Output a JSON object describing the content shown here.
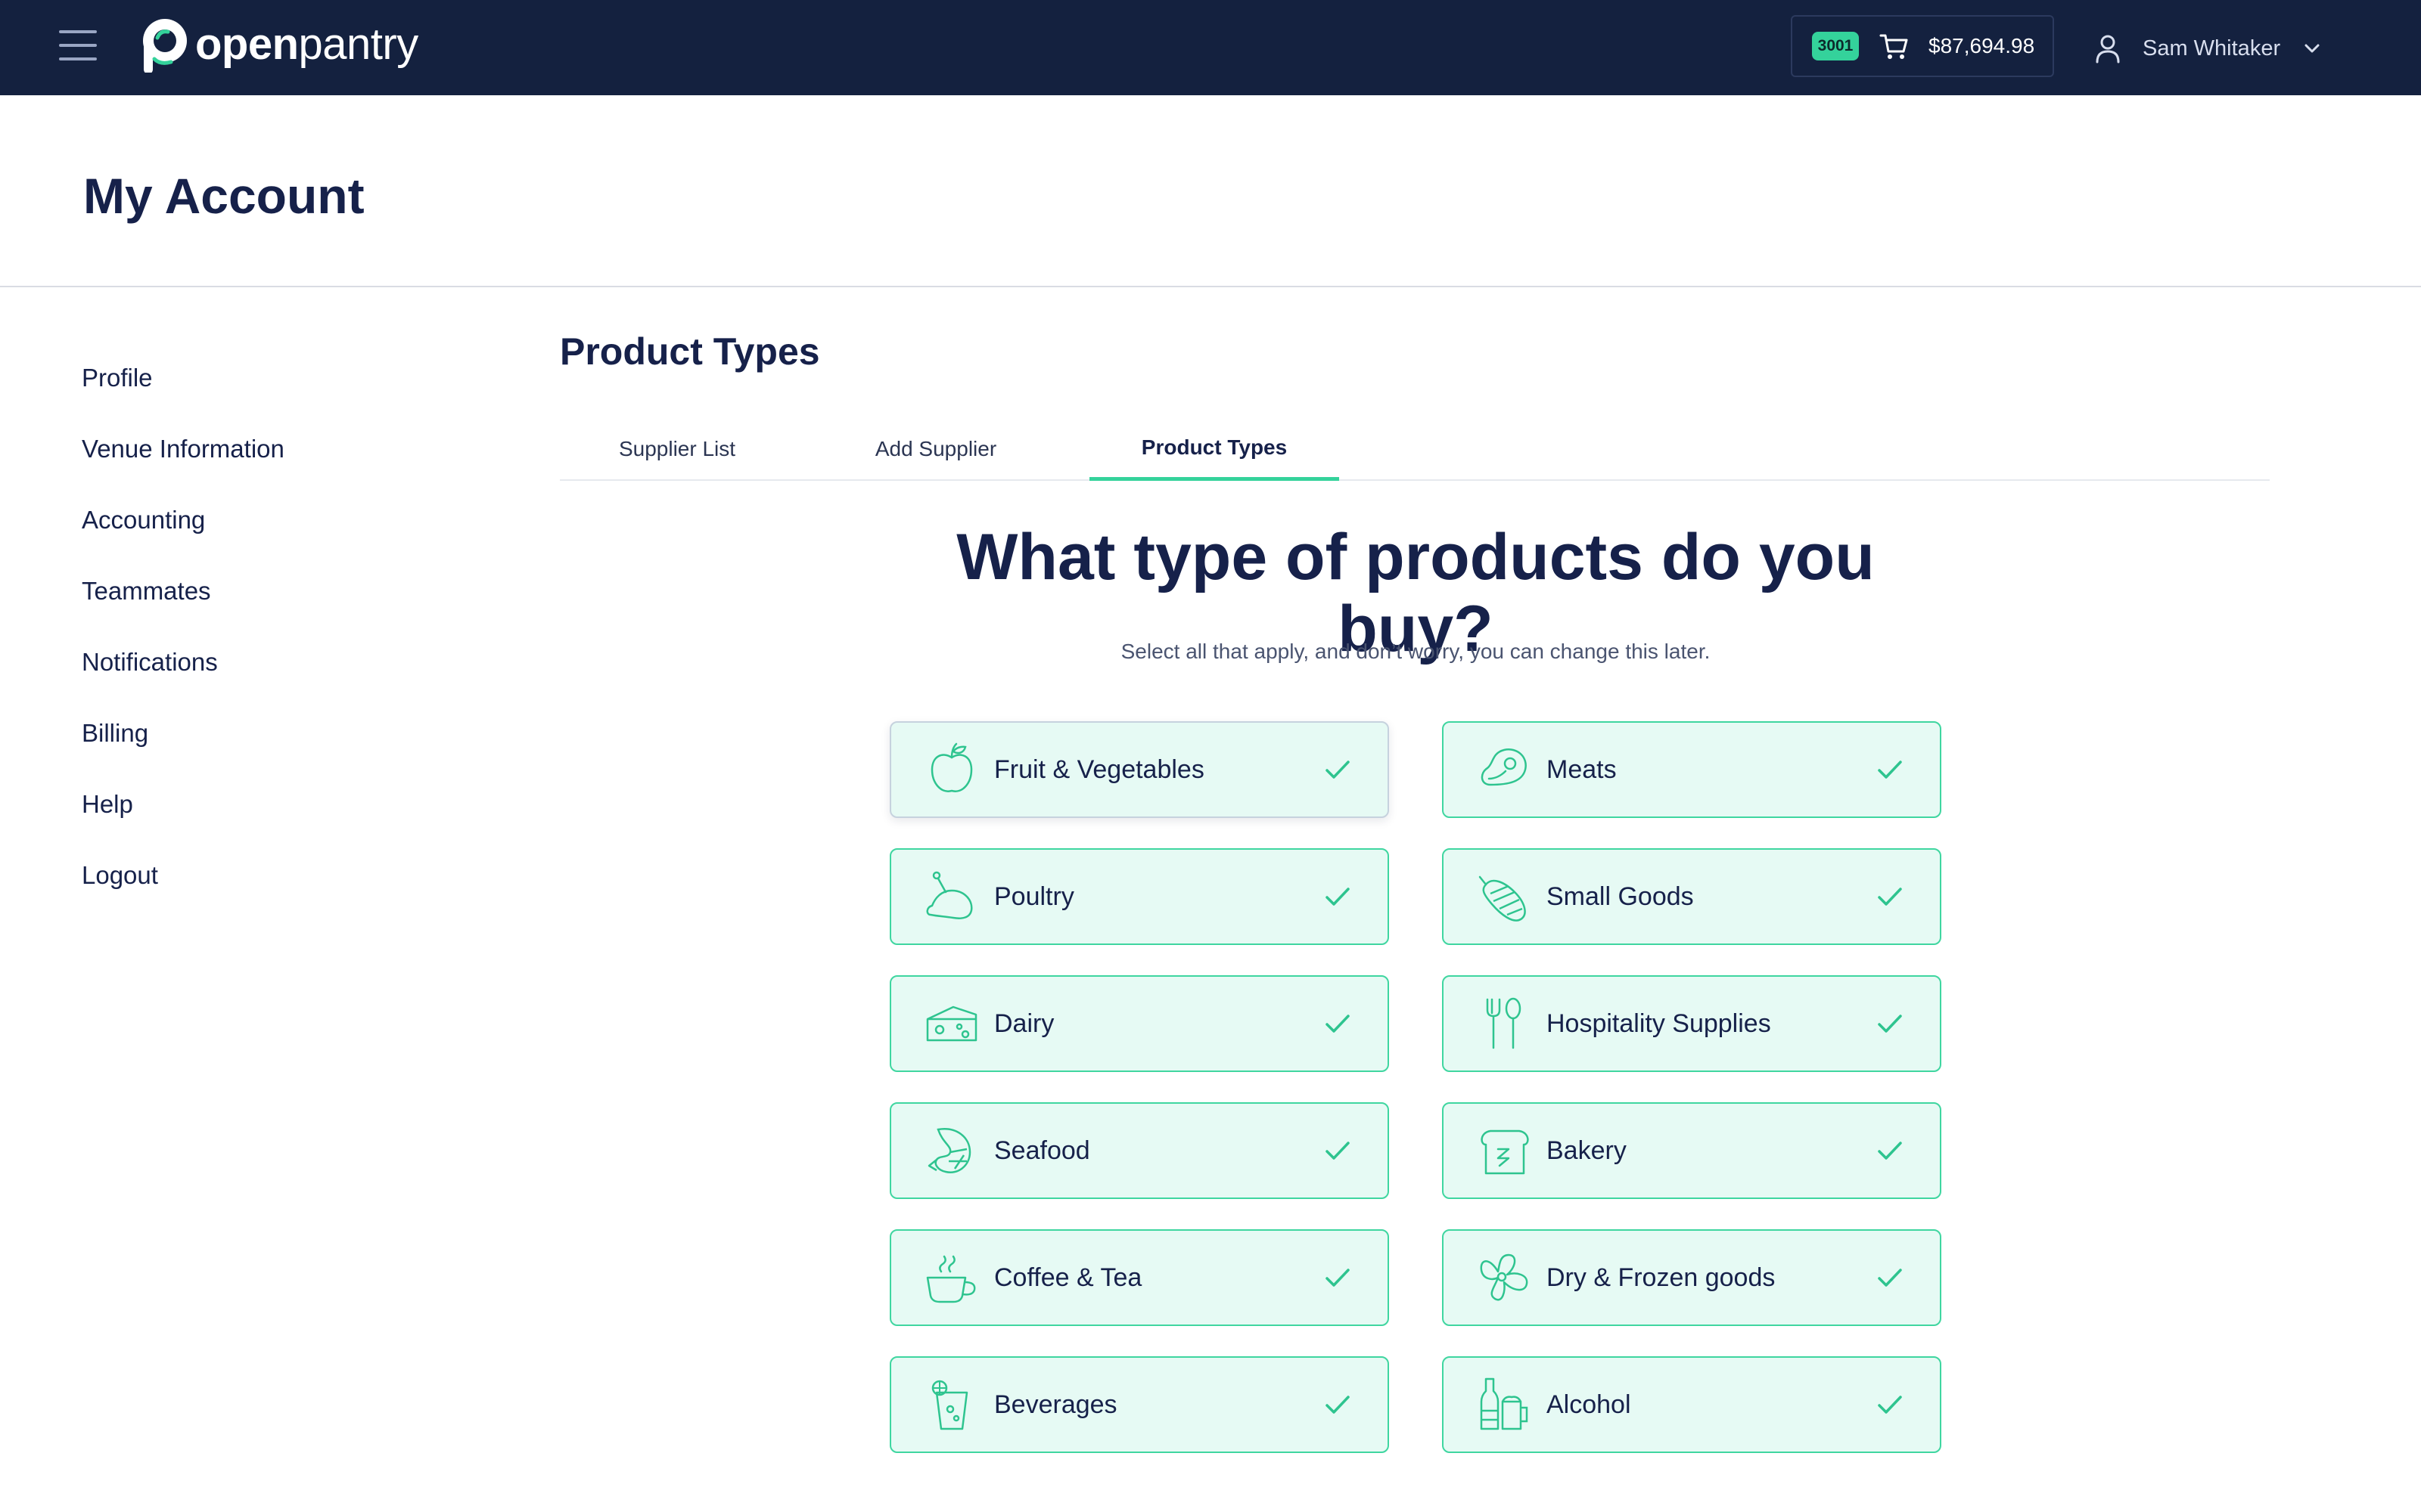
{
  "topbar": {
    "logo": {
      "open": "open",
      "pantry": "pantry"
    },
    "cart": {
      "badge": "3001",
      "total": "$87,694.98"
    },
    "user": {
      "name": "Sam Whitaker"
    }
  },
  "page": {
    "title": "My Account"
  },
  "sidebar": {
    "items": [
      {
        "label": "Profile"
      },
      {
        "label": "Venue Information"
      },
      {
        "label": "Accounting"
      },
      {
        "label": "Teammates"
      },
      {
        "label": "Notifications"
      },
      {
        "label": "Billing"
      },
      {
        "label": "Help"
      },
      {
        "label": "Logout"
      }
    ]
  },
  "main": {
    "section_title": "Product Types",
    "tabs": [
      {
        "label": "Supplier List",
        "active": false
      },
      {
        "label": "Add Supplier",
        "active": false
      },
      {
        "label": "Product Types",
        "active": true
      }
    ],
    "heading": "What type of products do you buy?",
    "subheading": "Select all that apply, and don’t worry, you can change this later.",
    "product_types": [
      {
        "label": "Fruit & Vegetables",
        "icon": "apple-icon",
        "selected": true
      },
      {
        "label": "Meats",
        "icon": "steak-icon",
        "selected": true
      },
      {
        "label": "Poultry",
        "icon": "chicken-icon",
        "selected": true
      },
      {
        "label": "Small Goods",
        "icon": "salami-icon",
        "selected": true
      },
      {
        "label": "Dairy",
        "icon": "cheese-icon",
        "selected": true
      },
      {
        "label": "Hospitality Supplies",
        "icon": "fork-spoon-icon",
        "selected": true
      },
      {
        "label": "Seafood",
        "icon": "shrimp-icon",
        "selected": true
      },
      {
        "label": "Bakery",
        "icon": "bread-icon",
        "selected": true
      },
      {
        "label": "Coffee & Tea",
        "icon": "cup-icon",
        "selected": true
      },
      {
        "label": "Dry & Frozen goods",
        "icon": "pasta-icon",
        "selected": true
      },
      {
        "label": "Beverages",
        "icon": "soda-glass-icon",
        "selected": true
      },
      {
        "label": "Alcohol",
        "icon": "bottle-beer-icon",
        "selected": true
      }
    ]
  },
  "colors": {
    "navbar": "#14213f",
    "accent": "#34d29b",
    "card_bg": "#e6faf4",
    "text_dark": "#16214a"
  }
}
